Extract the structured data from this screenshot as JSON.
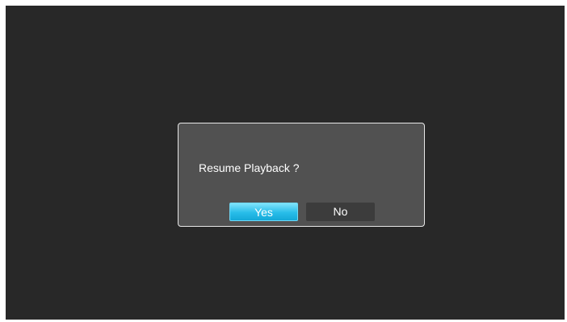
{
  "dialog": {
    "message": "Resume Playback ?",
    "buttons": {
      "yes_label": "Yes",
      "no_label": "No",
      "selected": "Yes"
    }
  },
  "colors": {
    "background": "#282828",
    "dialog": "#515151",
    "selected_button": "#28bde9",
    "unselected_button": "#3c3c3c",
    "text": "#ffffff"
  }
}
